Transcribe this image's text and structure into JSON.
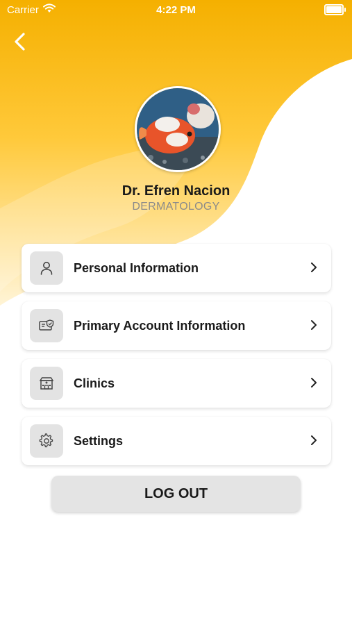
{
  "status_bar": {
    "carrier": "Carrier",
    "time": "4:22 PM"
  },
  "profile": {
    "name": "Dr. Efren Nacion",
    "specialty": "DERMATOLOGY"
  },
  "menu": {
    "items": [
      {
        "label": "Personal Information",
        "icon": "person-icon"
      },
      {
        "label": "Primary Account Information",
        "icon": "account-card-icon"
      },
      {
        "label": "Clinics",
        "icon": "clinic-building-icon"
      },
      {
        "label": "Settings",
        "icon": "gear-icon"
      }
    ]
  },
  "logout": {
    "label": "LOG OUT"
  },
  "colors": {
    "header_gradient_top": "#F5B300",
    "header_gradient_bottom": "#FFE082",
    "card_background": "#FFFFFF",
    "icon_tile": "#E3E3E3",
    "logout_background": "#E4E4E4",
    "text_primary": "#1A1A1A",
    "text_secondary": "#8A8A8A"
  }
}
